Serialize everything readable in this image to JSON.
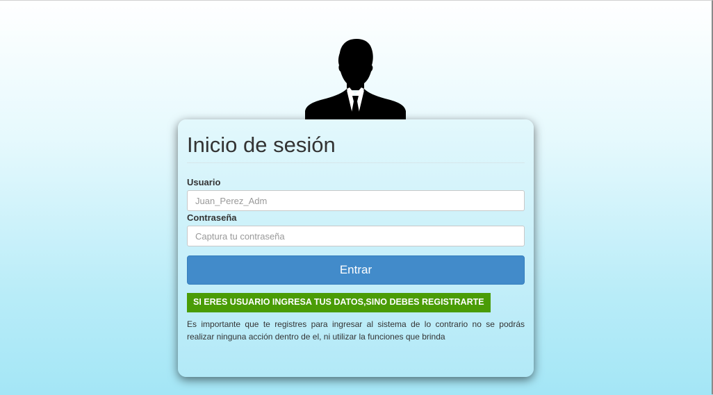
{
  "login": {
    "title": "Inicio de sesión",
    "username_label": "Usuario",
    "username_placeholder": "Juan_Perez_Adm",
    "password_label": "Contraseña",
    "password_placeholder": "Captura tu contraseña",
    "submit_label": "Entrar",
    "notice_text": "SI ERES USUARIO INGRESA TUS DATOS,SINO DEBES REGISTRARTE",
    "info_text": "Es importante que te registres para ingresar al sistema de lo contrario no se podrás realizar ninguna acción dentro de el, ni utilizar la funciones que brinda"
  },
  "icons": {
    "avatar": "user-silhouette-icon"
  },
  "colors": {
    "submit_button": "#428bca",
    "notice_background": "#4a9c06",
    "background_bottom": "#a4e6f6"
  }
}
